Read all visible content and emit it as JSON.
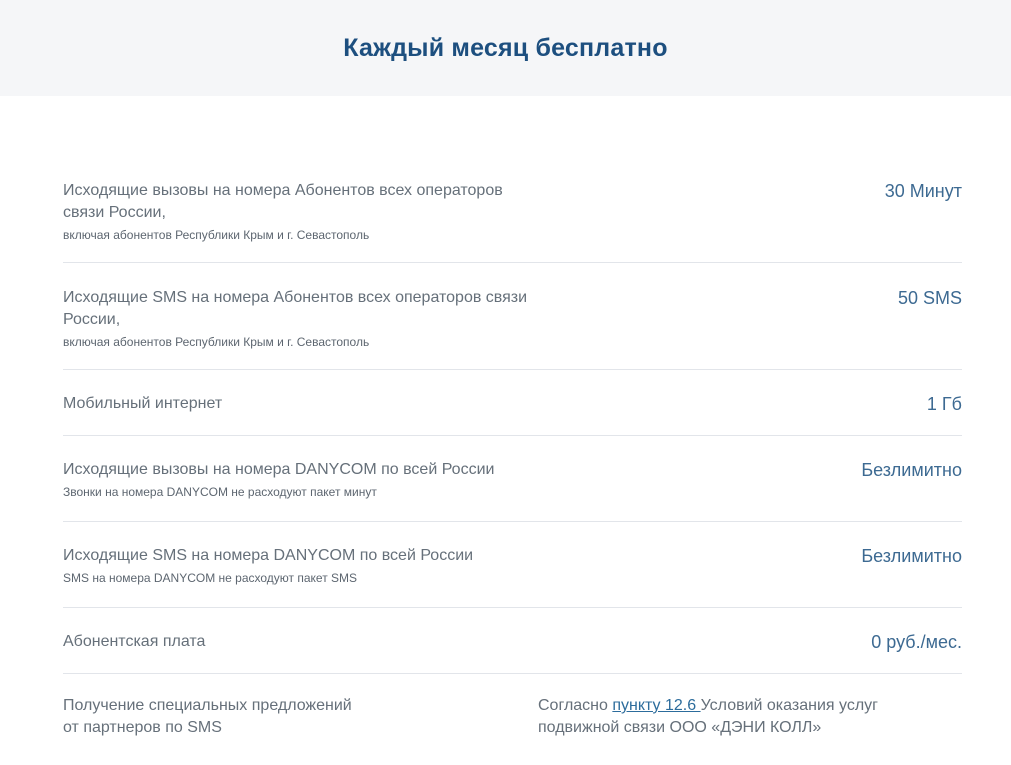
{
  "header": {
    "title": "Каждый месяц бесплатно"
  },
  "rows": [
    {
      "label": "Исходящие вызовы на номера Абонентов всех операторов связи России,",
      "sublabel": "включая абонентов Республики Крым и г. Севастополь",
      "value": "30 Минут"
    },
    {
      "label": "Исходящие SMS на номера Абонентов всех операторов связи России,",
      "sublabel": "включая абонентов Республики Крым и г. Севастополь",
      "value": "50 SMS"
    },
    {
      "label": "Мобильный интернет",
      "value": "1 Гб"
    },
    {
      "label": "Исходящие вызовы на номера DANYCOM по всей России",
      "sublabel": "Звонки на номера DANYCOM не расходуют пакет минут",
      "value": "Безлимитно"
    },
    {
      "label": "Исходящие SMS на номера DANYCOM по всей России",
      "sublabel": "SMS на номера DANYCOM не расходуют пакет SMS",
      "value": "Безлимитно"
    },
    {
      "label": "Абонентская плата",
      "value": "0 руб./мес."
    },
    {
      "label_line1": "Получение специальных предложений",
      "label_line2": "от партнеров по SMS",
      "note_prefix": "Согласно ",
      "note_link": "пункту 12.6 ",
      "note_suffix": "Условий оказания услуг подвижной связи ООО «ДЭНИ КОЛЛ»"
    }
  ],
  "colors": {
    "title": "#1d4f7f",
    "value": "#3d6a92",
    "text": "#66707a",
    "link": "#2c6c9c",
    "header_bg": "#f5f6f8",
    "divider": "#e2e5ea"
  }
}
